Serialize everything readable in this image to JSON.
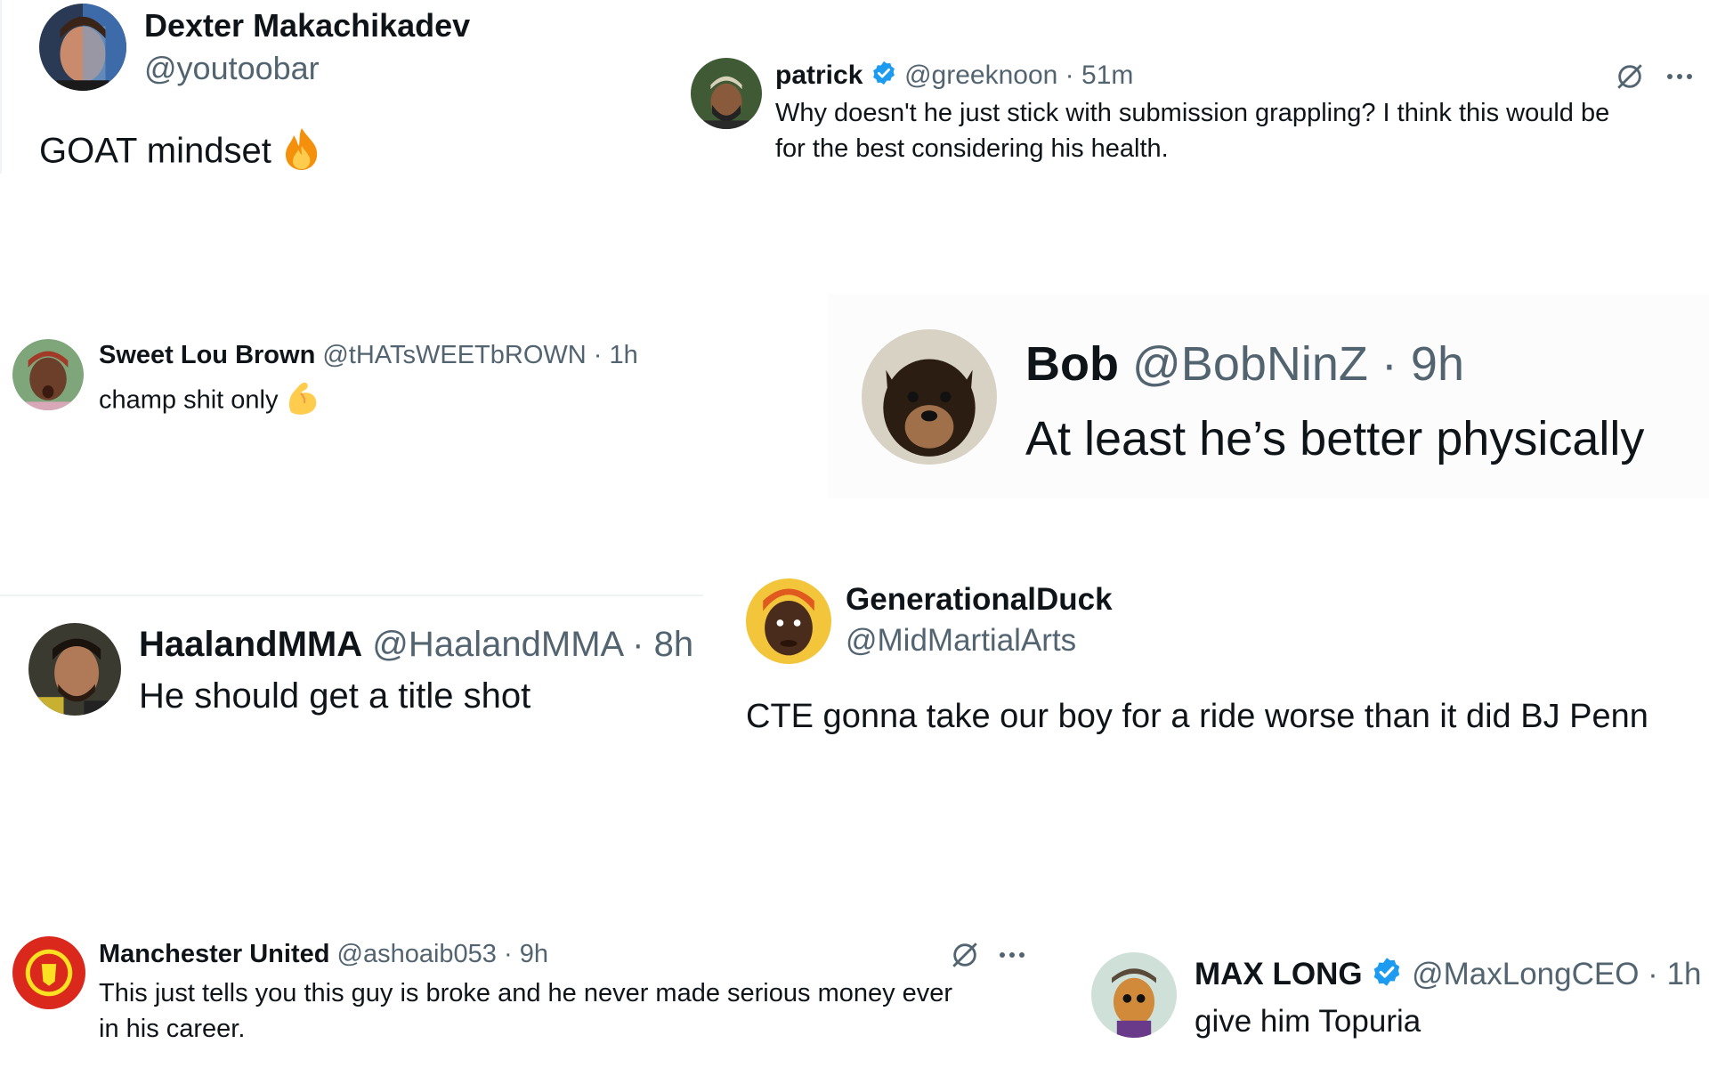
{
  "tweets": [
    {
      "name": "Dexter Makachikadev",
      "handle": "@youtoobar",
      "text": "GOAT mindset"
    },
    {
      "name": "patrick",
      "handle": "@greeknoon",
      "time": "51m",
      "text_line1": "Why doesn't he just stick with submission grappling? I think this would be",
      "text_line2": "for the best considering his health."
    },
    {
      "name": "Sweet Lou Brown",
      "handle": "@tHATsWEETbROWN",
      "time": "1h",
      "text": "champ shit only"
    },
    {
      "name": "Bob",
      "handle": "@BobNinZ",
      "time": "9h",
      "text": "At least he’s better physically"
    },
    {
      "name": "HaalandMMA",
      "handle": "@HaalandMMA",
      "time": "8h",
      "text": "He should get a title shot"
    },
    {
      "name": "GenerationalDuck",
      "handle": "@MidMartialArts",
      "text": "CTE gonna take our boy for a ride worse than it did BJ Penn"
    },
    {
      "name": "Manchester United",
      "handle": "@ashoaib053",
      "time": "9h",
      "text_line1": "This just tells you this guy is broke and he never made serious money ever",
      "text_line2": "in his career."
    },
    {
      "name": "MAX LONG",
      "handle": "@MaxLongCEO",
      "time": "1h",
      "text": "give him Topuria"
    }
  ],
  "separator": "·",
  "icons": {
    "grok": "grok-icon",
    "more": "more-icon",
    "verified": "verified-badge-icon",
    "fire": "fire-emoji-icon",
    "flex": "flexed-biceps-emoji-icon"
  },
  "colors": {
    "verified": "#1d9bf0",
    "secondary_text": "#536471",
    "primary_text": "#0f1419",
    "man_utd_red": "#da291c"
  }
}
